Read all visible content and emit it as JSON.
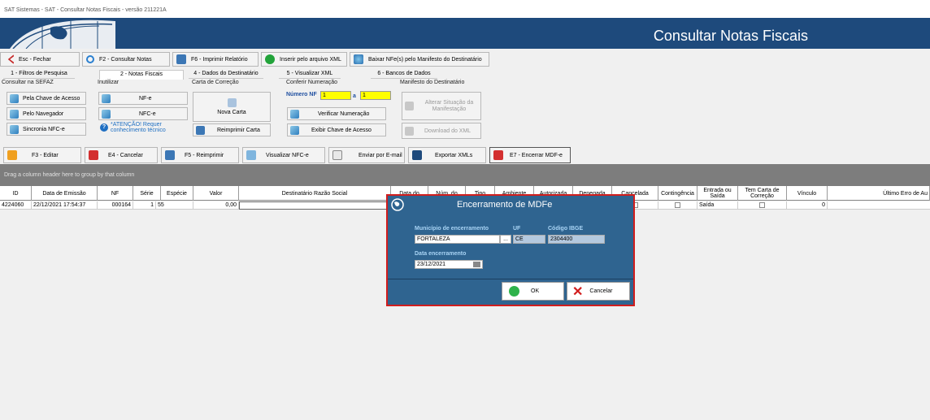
{
  "window": {
    "title": "SAT Sistemas - SAT - Consultar Notas Fiscais - versão 211221A"
  },
  "header": {
    "title": "Consultar Notas Fiscais"
  },
  "toolbar": [
    {
      "label": "Esc - Fechar",
      "icon": "close-icon"
    },
    {
      "label": "F2 - Consultar Notas",
      "icon": "search-icon"
    },
    {
      "label": "F6 - Imprimir Relatório",
      "icon": "printer-icon"
    },
    {
      "label": "Inserir pelo arquivo XML",
      "icon": "add-icon"
    },
    {
      "label": "Baixar NFe(s) pelo Manifesto do Destinatário",
      "icon": "globe-icon"
    }
  ],
  "tabs": [
    "1 - Filtros de Pesquisa",
    "2 - Notas Fiscais",
    "4 - Dados do Destinatário",
    "5 - Visualizar XML",
    "6 - Bancos de Dados"
  ],
  "groups": {
    "sefaz": {
      "title": "Consultar na SEFAZ",
      "b1": "Pela Chave de Acesso",
      "b2": "Pelo Navegador",
      "b3": "Sincronia NFC-e"
    },
    "inutilizar": {
      "title": "Inutilizar",
      "b1": "NF-e",
      "b2": "NFC-e",
      "warn": "*ATENÇÃO! Requer conhecimento técnico"
    },
    "carta": {
      "title": "Carta de Correção",
      "b1": "Nova Carta",
      "b2": "Reimprimir Carta"
    },
    "conferir": {
      "title": "Conferir Numeração",
      "nf_label": "Número NF",
      "nf_from": "1",
      "to_label": "a",
      "nf_to": "1",
      "b1": "Verificar Numeração",
      "b2": "Exibir Chave de Acesso"
    },
    "manifesto": {
      "title": "Manifesto do Destinatário",
      "b1": "Alterar Situação da Manifestação",
      "b2": "Download do XML"
    }
  },
  "actions": [
    "F3 - Editar",
    "E4 - Cancelar",
    "F5 - Reimprimir",
    "Visualizar NFC-e",
    "Enviar por E-mail",
    "Exportar XMLs",
    "E7 - Encerrar MDF-e"
  ],
  "grid": {
    "group_hint": "Drag a column header here to group by that column",
    "columns": [
      "ID",
      "Data de Emissão",
      "NF",
      "Série",
      "Espécie",
      "Valor",
      "Destinatário Razão Social",
      "Data do",
      "Núm. do",
      "Tipo",
      "Ambiente",
      "Autorizada",
      "Denegada",
      "Cancelada",
      "Contingência",
      "Entrada ou Saída",
      "Tem Carta de Correção",
      "Vínculo",
      "Último Erro de Au"
    ],
    "row": {
      "id": "4224060",
      "data": "22/12/2021 17:54:37",
      "nf": "000164",
      "serie": "1",
      "especie": "55",
      "valor": "0,00",
      "destinatario": "",
      "entrada": "Saída",
      "vinculo": "0"
    }
  },
  "modal": {
    "title": "Encerramento de MDFe",
    "municipio_label": "Município de encerramento",
    "municipio": "FORTALEZA",
    "lookup": "...",
    "uf_label": "UF",
    "uf": "CE",
    "ibge_label": "Código IBGE",
    "ibge": "2304400",
    "data_label": "Data encerramento",
    "data": "23/12/2021",
    "ok": "OK",
    "cancel": "Cancelar"
  }
}
